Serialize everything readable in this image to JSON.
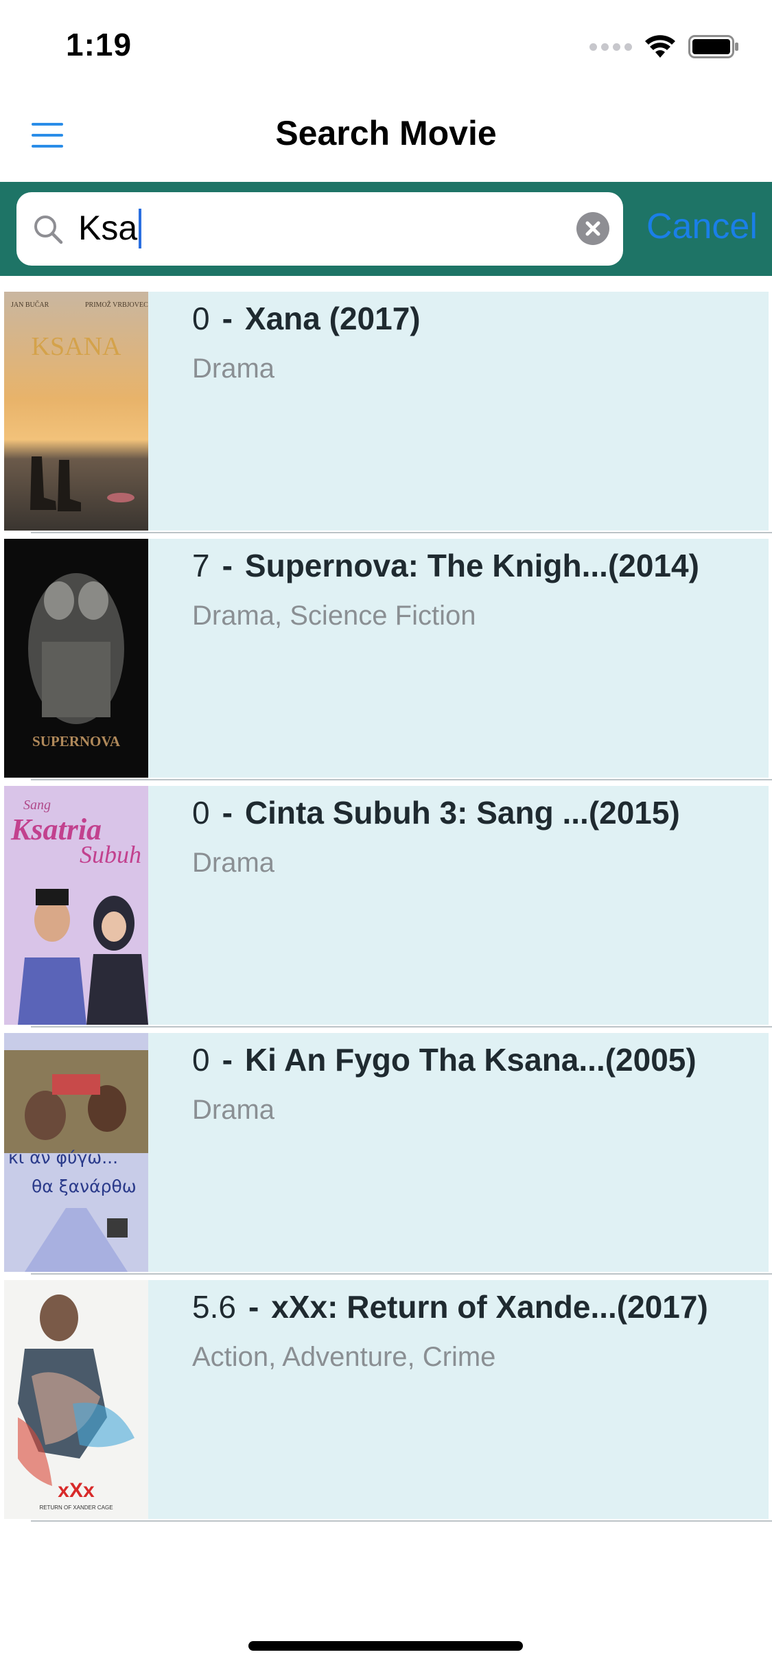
{
  "status_bar": {
    "time": "1:19"
  },
  "nav": {
    "title": "Search Movie",
    "menu_icon": "hamburger-menu-icon"
  },
  "search": {
    "value": "Ksa",
    "cancel_label": "Cancel",
    "search_icon": "magnifier-icon",
    "clear_icon": "clear-circle-x-icon"
  },
  "colors": {
    "search_strip": "#1e7466",
    "row_background": "#e0f1f4",
    "accent_blue": "#1a7fe8"
  },
  "results": [
    {
      "rating": "0",
      "title": "Xana (2017)",
      "genres": "Drama",
      "poster_text": [
        "JAN BUČAR",
        "PRIMOŽ VRBJOVEC",
        "KSANA"
      ]
    },
    {
      "rating": "7",
      "title": "Supernova: The Knigh...(2014)",
      "genres": "Drama, Science Fiction",
      "poster_text": [
        "SUPERNOVA"
      ]
    },
    {
      "rating": "0",
      "title": "Cinta Subuh 3: Sang ...(2015)",
      "genres": "Drama",
      "poster_text": [
        "Sang",
        "Ksatria",
        "Subuh"
      ]
    },
    {
      "rating": "0",
      "title": "Ki An Fygo Tha Ksana...(2005)",
      "genres": "Drama",
      "poster_text": [
        "κι αν φύγω...",
        "θα ξανάρθω"
      ]
    },
    {
      "rating": "5.6",
      "title": "xXx: Return of Xande...(2017)",
      "genres": "Action, Adventure, Crime",
      "poster_text": [
        "xXx",
        "RETURN OF XANDER CAGE"
      ]
    }
  ]
}
